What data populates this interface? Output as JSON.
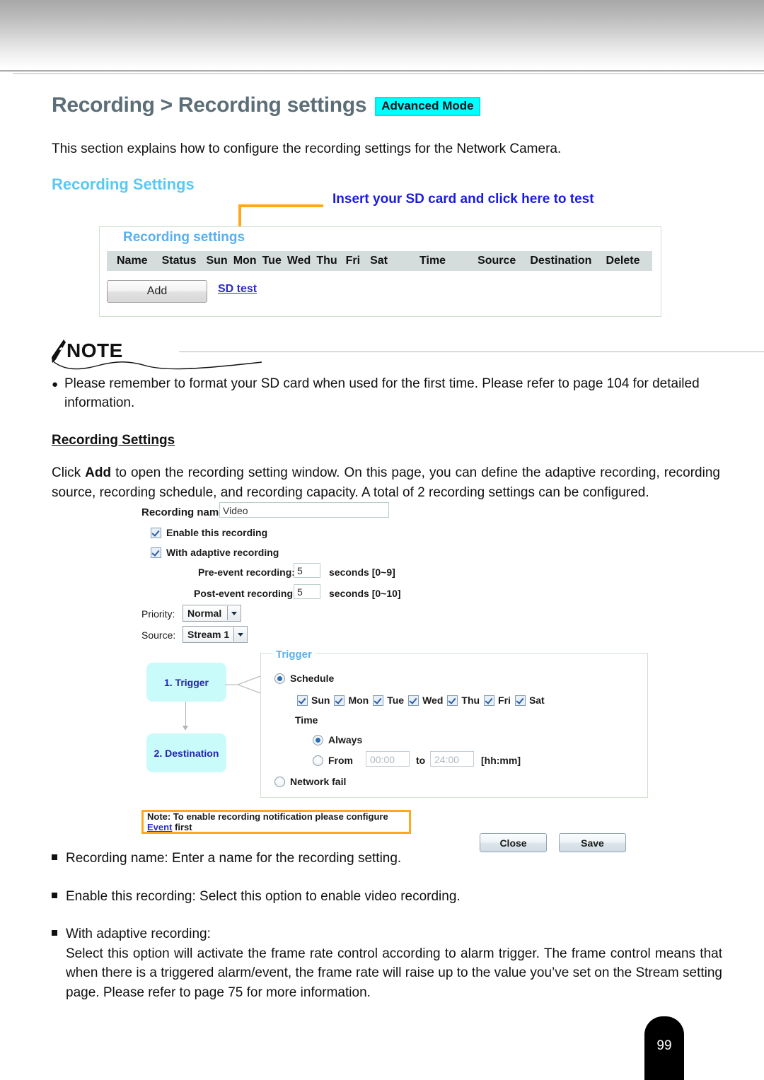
{
  "header": {
    "title": "Recording > Recording settings",
    "badge": "Advanced Mode"
  },
  "intro": "This section explains how to configure the recording settings for the Network Camera.",
  "section_heading": "Recording Settings",
  "callout": {
    "text": "Insert your SD card and click here to test",
    "line_color": "#FFA81E"
  },
  "recording_settings_panel": {
    "legend": "Recording settings",
    "columns": [
      "Name",
      "Status",
      "Sun",
      "Mon",
      "Tue",
      "Wed",
      "Thu",
      "Fri",
      "Sat",
      "Time",
      "Source",
      "Destination",
      "Delete"
    ],
    "add_button": "Add",
    "sd_test_link": "SD test"
  },
  "note": {
    "label": "NOTE",
    "bullet": "●",
    "text": "Please remember to format your SD card when used for the first time. Please refer to page 104 for detailed information."
  },
  "sub_heading": "Recording Settings",
  "paragraph": {
    "pre": "Click ",
    "bold": "Add",
    "post": " to open the recording setting window. On this page, you can define the adaptive recording, recording source, recording schedule, and recording capacity. A total of 2 recording settings can be configured."
  },
  "dialog": {
    "recording_name_label": "Recording name:",
    "recording_name_value": "Video",
    "enable_recording_label": "Enable this recording",
    "enable_recording_checked": true,
    "adaptive_recording_label": "With adaptive recording",
    "adaptive_recording_checked": true,
    "pre_event_label": "Pre-event recording:",
    "pre_event_value": "5",
    "pre_event_unit": "seconds [0~9]",
    "post_event_label": "Post-event recording:",
    "post_event_value": "5",
    "post_event_unit": "seconds [0~10]",
    "priority_label": "Priority:",
    "priority_value": "Normal",
    "source_label": "Source:",
    "source_value": "Stream 1",
    "flow": {
      "step1": "1. Trigger",
      "step2": "2. Destination"
    },
    "trigger": {
      "legend": "Trigger",
      "schedule_label": "Schedule",
      "schedule_selected": true,
      "days": [
        {
          "label": "Sun",
          "checked": true
        },
        {
          "label": "Mon",
          "checked": true
        },
        {
          "label": "Tue",
          "checked": true
        },
        {
          "label": "Wed",
          "checked": true
        },
        {
          "label": "Thu",
          "checked": true
        },
        {
          "label": "Fri",
          "checked": true
        },
        {
          "label": "Sat",
          "checked": true
        }
      ],
      "time_label": "Time",
      "always_label": "Always",
      "always_selected": true,
      "from_label": "From",
      "from_value": "00:00",
      "to_label": "to",
      "to_value": "24:00",
      "format_hint": "[hh:mm]",
      "network_fail_label": "Network fail",
      "network_fail_selected": false
    },
    "note_banner": {
      "pre": "Note: To enable recording notification please configure ",
      "link": "Event",
      "post": " first"
    },
    "close_button": "Close",
    "save_button": "Save"
  },
  "bullets": [
    {
      "title": "Recording name: Enter a name for the recording setting.",
      "body": ""
    },
    {
      "title": "Enable this recording: Select this option to enable video recording.",
      "body": ""
    },
    {
      "title": "With adaptive recording:",
      "body": "Select this option will activate the frame rate control according to alarm trigger. The frame control means that when there is a triggered alarm/event, the frame rate will raise up to the value you’ve set on the Stream setting page. Please refer to page 75 for more information."
    }
  ],
  "page_number": "99"
}
